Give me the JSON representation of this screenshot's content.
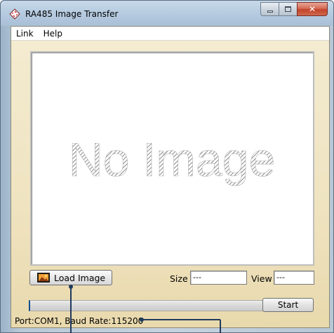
{
  "window": {
    "title": "RA485 Image Transfer",
    "controls": {
      "minimize_icon": "minimize-icon",
      "maximize_icon": "maximize-icon",
      "close_glyph": "✕"
    }
  },
  "menu": {
    "items": [
      {
        "label": "Link"
      },
      {
        "label": "Help"
      }
    ]
  },
  "image_panel": {
    "placeholder_text": "No Image"
  },
  "controls": {
    "load_label": "Load Image",
    "size_label": "Size",
    "size_value": "---",
    "view_label": "View",
    "view_value": "---",
    "start_label": "Start",
    "progress_percent": 0
  },
  "status": {
    "text": "Port:COM1, Baud Rate:115200"
  },
  "colors": {
    "accent": "#0f4f8a",
    "client_bg": "#efe3c0",
    "close_red": "#c24329"
  }
}
